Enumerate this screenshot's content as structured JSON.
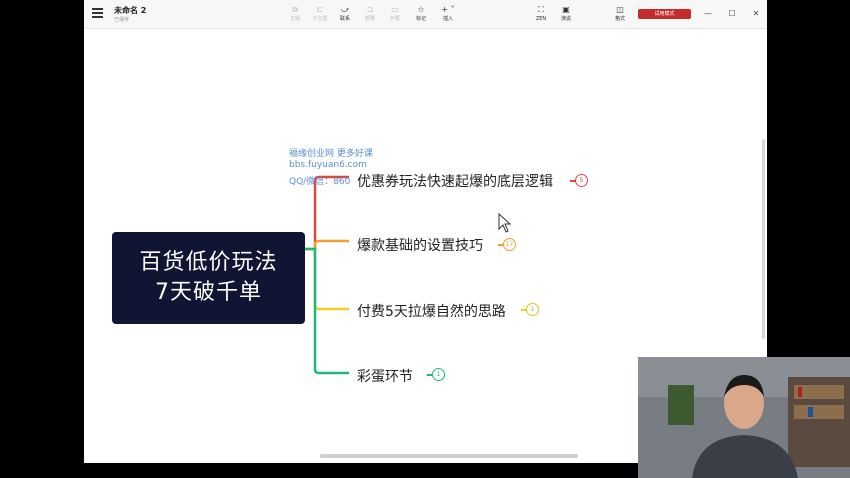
{
  "window": {
    "doc_title": "未命名 2",
    "doc_status": "已保存",
    "trial_label": "试用模式"
  },
  "toolbar": {
    "items": [
      {
        "label": "主题",
        "icon": "topic-icon",
        "enabled": false
      },
      {
        "label": "子主题",
        "icon": "subtopic-icon",
        "enabled": false
      },
      {
        "label": "联系",
        "icon": "relationship-icon",
        "enabled": true
      },
      {
        "label": "概要",
        "icon": "summary-icon",
        "enabled": false
      },
      {
        "label": "外框",
        "icon": "boundary-icon",
        "enabled": false
      },
      {
        "label": "标记",
        "icon": "star-icon",
        "enabled": true
      },
      {
        "label": "插入",
        "icon": "plus-icon",
        "enabled": true
      },
      {
        "label": "ZEN",
        "icon": "zen-icon",
        "enabled": true
      },
      {
        "label": "演说",
        "icon": "pitch-icon",
        "enabled": true
      },
      {
        "label": "格式",
        "icon": "format-icon",
        "enabled": true
      }
    ]
  },
  "watermark": {
    "lines": [
      "福缘创业网 更多好课",
      "bbs.fuyuan6.com",
      "QQ/微信：860"
    ]
  },
  "mindmap": {
    "root": {
      "line1": "百货低价玩法",
      "line2": "7天破千单",
      "color": "#0f1533"
    },
    "branches": [
      {
        "label": "优惠券玩法快速起爆的底层逻辑",
        "count": "5",
        "color": "#e04545"
      },
      {
        "label": "爆款基础的设置技巧",
        "count": "17",
        "color": "#f0a030"
      },
      {
        "label": "付费5天拉爆自然的思路",
        "count": "1",
        "color": "#f0d020"
      },
      {
        "label": "彩蛋环节",
        "count": "1",
        "color": "#1cb878"
      }
    ]
  }
}
